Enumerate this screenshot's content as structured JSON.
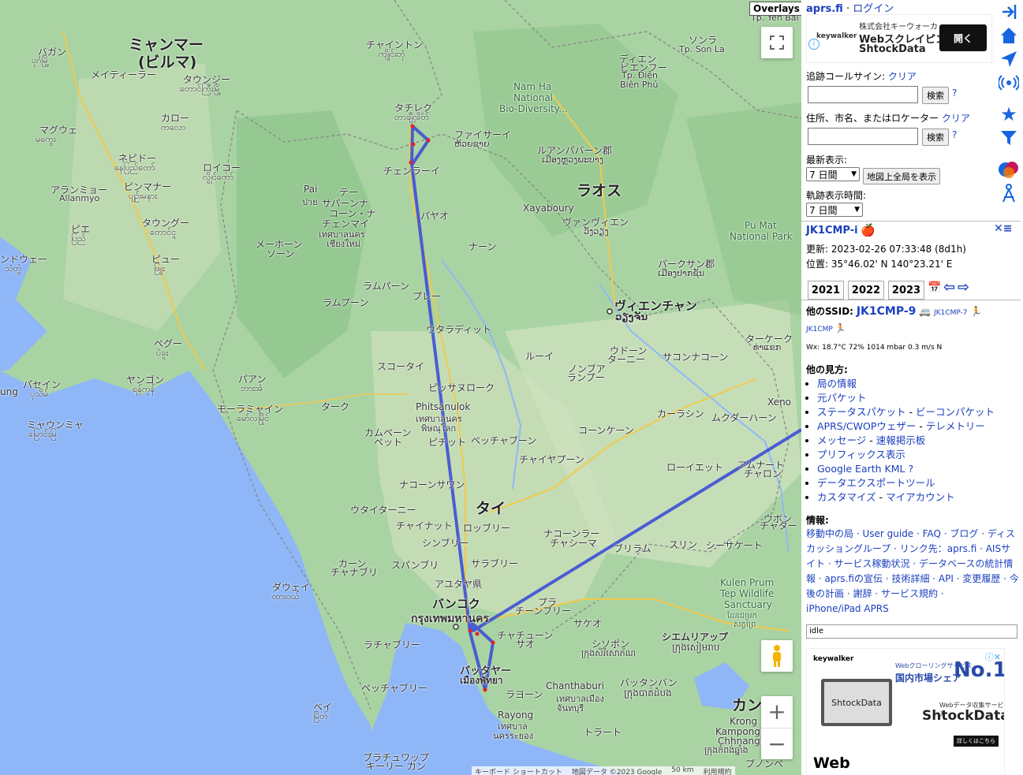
{
  "map": {
    "overlays_label": "Overlays",
    "labels": {
      "myanmar": "ミャンマー",
      "myanmar2": "(ビルマ)",
      "laos": "ラオス",
      "thai": "タイ",
      "cambodia": "カンボ",
      "bagan": "バガン",
      "bagan_my": "ပုဂံမြို့",
      "meiktila": "メイティーラー",
      "taunggyi": "タウンジー",
      "taunggyi_my": "တောင်ကြီးမြို့",
      "magway": "マグウェ",
      "magway_my": "မကွေး",
      "kalaw": "カロー",
      "kalaw_my": "ကလော",
      "naypyidaw": "ネピドー",
      "naypyidaw_my": "နေပြည်တော်",
      "pyinmana": "ピンマナー",
      "pyinmana_my": "ပျဉ်းမနား",
      "loikaw": "ロイコー",
      "loikaw_my": "လွိုင်ကော်",
      "allanmyo": "アランミョー",
      "allanmyo_en": "Allanmyo",
      "toungoo": "タウングー",
      "toungoo_my": "တောင်ငူ",
      "pyay": "ピエ",
      "pyay_my": "ပြည်",
      "pyu": "ピュー",
      "pyu_my": "ဖြူး",
      "thandwe": "ンドウェー",
      "thandwe_my": "သံတွဲ",
      "bago": "ペグー",
      "bago_my": "ပဲခူး",
      "yangon": "ヤンゴン",
      "yangon_my": "ရန်ကုန်",
      "pathein": "パセイン",
      "pathein_my": "ပုသိမ်",
      "ung": "ung",
      "mawlamyine": "モーラミャイン",
      "mawlamyine_my": "မော်လမြိုင်",
      "myaungmya": "ミャウンミャ",
      "myaungmya_my": "မြောင်းမြ",
      "hpaan": "パアン",
      "hpaan_my": "ဘားအံ",
      "dawei": "ダウェイ",
      "dawei_my": "ထားဝယ်",
      "myeik": "ベイ",
      "myeik_my": "မြိတ်",
      "chaingtong": "チャイントン",
      "chaingtong_my": "ကျိုင်းတုံ",
      "tachileik": "タチレク",
      "tachileik_my": "တာချီလိတ်",
      "houayxay": "ファイサーイ",
      "houayxay_lo": "ຫ້ວຍຊາຍ",
      "chiangrai": "チェンラーイ",
      "pai": "Pai",
      "pai_th": "ปาย",
      "tee": "テー",
      "sapan": "サパーンナ",
      "chiangmai": "コーン・ナ",
      "chiangmai2": "チェンマイ",
      "chiangmai_th": "เทศบาลนคร",
      "chiangmai_th2": "เชียงใหม่",
      "maehongson": "メーホーン",
      "maehongson2": "ソーン",
      "phayao": "パヤオ",
      "nan": "ナーン",
      "lampang": "ラムパーン",
      "lamphun": "ラムプーン",
      "phrae": "プレー",
      "uttaradit": "ウタラディット",
      "sukhothai": "スコータイ",
      "tak": "ターク",
      "phitsanulok": "ピッサヌローク",
      "phitsanulok_en": "Phitsanulok",
      "phitsanulok_th": "เทศบาลนคร",
      "phitsanulok_th2": "พิษณุโลก",
      "kamphaeng": "カムペーン",
      "kamphaeng2": "ペット",
      "phichit": "ピチット",
      "phetchabun": "ペッチャブーン",
      "nakhonsawan": "ナコーンサワン",
      "chaiyaphum": "チャイヤプーン",
      "uthaithani": "ウタイターニー",
      "chainat": "チャイナット",
      "lopburi": "ロッブリー",
      "singburi": "シンブリー",
      "suphanburi": "スパンブリ",
      "kanchanaburi": "カーン",
      "kanchanaburi2": "チャナブリ",
      "saraburi": "サラブリー",
      "ayutthaya": "アユタヤ県",
      "bangkok": "バンコク",
      "bangkok_th": "กรุงเทพมหานคร",
      "ratchaburi": "ラチャブリー",
      "chachoengsao": "チャチューン",
      "chachoengsao2": "サオ",
      "pattaya": "パッタヤー",
      "pattaya_th": "เมืองพัทยา",
      "phetchaburi": "ペッチャブリー",
      "prachuap": "プラチュワップ",
      "prachuap2": "キーリー カン",
      "rayong": "ラヨーン",
      "rayong2": "Rayong",
      "rayong_th": "เทศบาล",
      "rayong_th2": "นครระยอง",
      "chanthaburi": "Chanthaburi",
      "chanthaburi_th": "เทศบาลเมือง",
      "chanthaburi_th2": "จันทบุรี",
      "trat": "トラート",
      "sakaeo": "サケオ",
      "prachinburi": "プラ",
      "prachinburi2": "チーンブリー",
      "nakhonratchasima": "ナコーンラー",
      "nakhonratchasima2": "チャシーマ",
      "buriram": "ブリラム",
      "surin": "スリン",
      "sisaket": "シーサケート",
      "khonkaen": "コーンケーン",
      "kalasin": "カーラシン",
      "mukdahan": "ムクダーハーン",
      "roiet": "ローイエット",
      "amnat": "アムナート",
      "amnat2": "チャロン",
      "ubon": "ウボン",
      "ubon2": "チャター",
      "udon": "ウドーン",
      "udon2": "ターニー",
      "nongbua": "ノンブア",
      "nongbua2": "ランプー",
      "loei": "ルーイ",
      "sakon": "サコンナコーン",
      "thakhek": "ターケーク",
      "thakhek_lo": "ທ່າແຂກ",
      "xeno": "Xeno",
      "vientiane": "ヴィエンチャン",
      "vientiane_lo": "ວຽງຈັນ",
      "paksan": "パークサン郡",
      "paksan_lo": "ເມືອງປາກຊັນ",
      "vangvieng": "ヴァンヴィエン",
      "vangvieng_lo": "ວັງວຽງ",
      "xayaboury": "Xayaboury",
      "luangprabang": "ルアンパバーン郡",
      "luangprabang_lo": "ເມືອງຫຼວງພະບາງ",
      "namha": "Nam Ha",
      "namha2": "National",
      "namha3": "Bio-Diversity...",
      "pumat": "Pu Mat",
      "pumat2": "National Park",
      "kulen": "Kulen Prum",
      "kulen2": "Tep Wildlife",
      "kulen3": "Sanctuary",
      "kulen_kh": "ដែនជម្រក",
      "kulen_kh2": "សត្វព្រៃ",
      "siemreap": "シエムリアップ",
      "siemreap_kh": "ក្រុងសៀមរាប",
      "sisophon": "シソポン",
      "sisophon_kh": "ក្រុងសិរីសោភ័ណ",
      "battambang": "バッタンバン",
      "battambang_kh": "ក្រុងបាត់ដំបង",
      "krong": "Krong",
      "krong2": "Kampong",
      "krong3": "Chhnang",
      "krong_kh": "ក្រុងកំពង់ឆ្នាំង",
      "phnompenh": "プノンペ",
      "yenbai": "Tp. Yên Bái",
      "sonla": "ソンラ",
      "sonla2": "Tp. Son La",
      "dienbien": "ディエン",
      "dienbien2": "ビエンフー",
      "dienbien3": "Tp. Điện",
      "dienbien4": "Biên Phủ"
    },
    "roads": [
      "AH1",
      "AH1",
      "AH1",
      "AH1",
      "AH13",
      "AH13",
      "17A",
      "2W",
      "13",
      "1C",
      "2E",
      "6",
      "6A",
      "7",
      "1",
      "4",
      "13",
      "10",
      "13",
      "8",
      "1E",
      "13",
      "68",
      "6",
      "62",
      "5",
      "55",
      "48"
    ],
    "attribution": [
      "キーボード ショートカット",
      "地図データ ©2023 Google",
      "50 km",
      "利用規約"
    ]
  },
  "panel": {
    "site": "aprs.fi",
    "sep": "·",
    "login": "ログイン",
    "ad_top": {
      "brand": "keywalker",
      "company": "株式会社キーウォーカ",
      "title": "Webスクレイピン",
      "product": "ShtockData",
      "open": "開く"
    },
    "track_label": "追跡コールサイン:",
    "clear": "クリア",
    "search": "検索",
    "help": "?",
    "address_label": "住所、市名、またはロケーター",
    "latest_label": "最新表示:",
    "latest_value": "7 日間",
    "show_all": "地図上全局を表示",
    "track_time_label": "軌跡表示時間:",
    "track_time_value": "7 日間",
    "station": "JK1CMP-i",
    "updated": "更新: 2023-02-26 07:33:48 (8d1h)",
    "position": "位置: 35°46.02' N 140°23.21' E",
    "years": [
      "2021",
      "2022",
      "2023"
    ],
    "ssid_label": "他のSSID:",
    "ssid_main": "JK1CMP-9",
    "ssid_2": "JK1CMP-7",
    "ssid_3": "JK1CMP",
    "wx": "Wx: 18.7°C 72% 1014 mbar 0.3 m/s N",
    "views_label": "他の見方:",
    "views": [
      [
        "局の情報"
      ],
      [
        "元パケット"
      ],
      [
        "ステータスパケット",
        "ビーコンパケット"
      ],
      [
        "APRS/CWOPウェザー",
        "テレメトリー"
      ],
      [
        "メッセージ",
        "速報掲示板"
      ],
      [
        "プリフィックス表示"
      ],
      [
        "Google Earth KML ?"
      ],
      [
        "データエクスポートツール"
      ],
      [
        "カスタマイズ",
        "マイアカウント"
      ]
    ],
    "info_label": "情報:",
    "info_links": [
      "移動中の局",
      "User guide",
      "FAQ",
      "ブログ",
      "ディスカッショングループ",
      "リンク先：aprs.fi",
      "AISサイト",
      "サービス稼動状況",
      "データベースの統計情報",
      "aprs.fiの宣伝",
      "技術詳細",
      "API",
      "変更履歴",
      "今後の計画",
      "謝辞",
      "サービス規約",
      "iPhone/iPad APRS"
    ],
    "status": "idle",
    "ad_bottom": {
      "brand": "keywalker",
      "small": "Webクローリングサービス",
      "share": "国内市場シェア",
      "no1": "No.1",
      "sub": "Webデータ収集サービス",
      "product": "ShtockData",
      "screen": "ShtockData",
      "more": "詳しくはこちら",
      "web": "Web"
    }
  },
  "colors": {
    "track": "#3d4fd6",
    "point": "#e0202c",
    "link": "#1a3fbf",
    "land": "#a8d2a0",
    "sea": "#8fb7f7"
  }
}
